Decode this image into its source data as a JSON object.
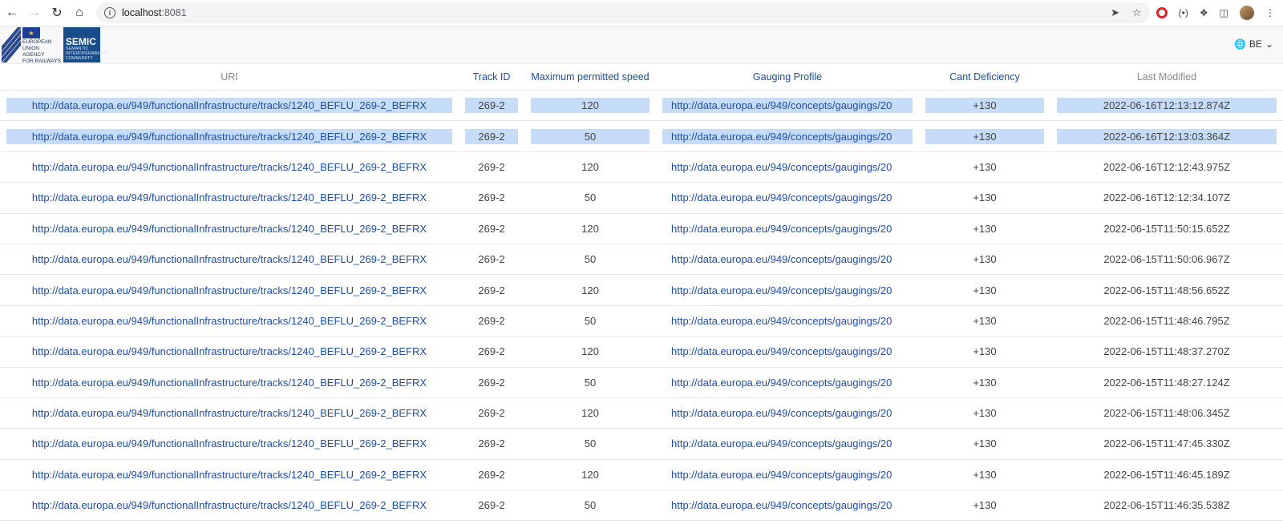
{
  "browser": {
    "url_host": "localhost",
    "url_port": ":8081"
  },
  "header": {
    "era_logo_text": [
      "EUROPEAN",
      "UNION",
      "AGENCY",
      "FOR RAILWAYS"
    ],
    "semic_title": "SEMIC",
    "semic_subtitle": [
      "SEMANTIC",
      "INTEROPERABILITY",
      "COMMUNITY"
    ],
    "language": "BE"
  },
  "table": {
    "columns": [
      "URI",
      "Track ID",
      "Maximum permitted speed",
      "Gauging Profile",
      "Cant Deficiency",
      "Last Modified"
    ],
    "rows": [
      {
        "uri": "http://data.europa.eu/949/functionalInfrastructure/tracks/1240_BEFLU_269-2_BEFRX",
        "track": "269-2",
        "speed": "120",
        "gauge": "http://data.europa.eu/949/concepts/gaugings/20",
        "cant": "+130",
        "modified": "2022-06-16T12:13:12.874Z",
        "selected": true
      },
      {
        "uri": "http://data.europa.eu/949/functionalInfrastructure/tracks/1240_BEFLU_269-2_BEFRX",
        "track": "269-2",
        "speed": "50",
        "gauge": "http://data.europa.eu/949/concepts/gaugings/20",
        "cant": "+130",
        "modified": "2022-06-16T12:13:03.364Z",
        "selected": true
      },
      {
        "uri": "http://data.europa.eu/949/functionalInfrastructure/tracks/1240_BEFLU_269-2_BEFRX",
        "track": "269-2",
        "speed": "120",
        "gauge": "http://data.europa.eu/949/concepts/gaugings/20",
        "cant": "+130",
        "modified": "2022-06-16T12:12:43.975Z",
        "selected": false
      },
      {
        "uri": "http://data.europa.eu/949/functionalInfrastructure/tracks/1240_BEFLU_269-2_BEFRX",
        "track": "269-2",
        "speed": "50",
        "gauge": "http://data.europa.eu/949/concepts/gaugings/20",
        "cant": "+130",
        "modified": "2022-06-16T12:12:34.107Z",
        "selected": false
      },
      {
        "uri": "http://data.europa.eu/949/functionalInfrastructure/tracks/1240_BEFLU_269-2_BEFRX",
        "track": "269-2",
        "speed": "120",
        "gauge": "http://data.europa.eu/949/concepts/gaugings/20",
        "cant": "+130",
        "modified": "2022-06-15T11:50:15.652Z",
        "selected": false
      },
      {
        "uri": "http://data.europa.eu/949/functionalInfrastructure/tracks/1240_BEFLU_269-2_BEFRX",
        "track": "269-2",
        "speed": "50",
        "gauge": "http://data.europa.eu/949/concepts/gaugings/20",
        "cant": "+130",
        "modified": "2022-06-15T11:50:06.967Z",
        "selected": false
      },
      {
        "uri": "http://data.europa.eu/949/functionalInfrastructure/tracks/1240_BEFLU_269-2_BEFRX",
        "track": "269-2",
        "speed": "120",
        "gauge": "http://data.europa.eu/949/concepts/gaugings/20",
        "cant": "+130",
        "modified": "2022-06-15T11:48:56.652Z",
        "selected": false
      },
      {
        "uri": "http://data.europa.eu/949/functionalInfrastructure/tracks/1240_BEFLU_269-2_BEFRX",
        "track": "269-2",
        "speed": "50",
        "gauge": "http://data.europa.eu/949/concepts/gaugings/20",
        "cant": "+130",
        "modified": "2022-06-15T11:48:46.795Z",
        "selected": false
      },
      {
        "uri": "http://data.europa.eu/949/functionalInfrastructure/tracks/1240_BEFLU_269-2_BEFRX",
        "track": "269-2",
        "speed": "120",
        "gauge": "http://data.europa.eu/949/concepts/gaugings/20",
        "cant": "+130",
        "modified": "2022-06-15T11:48:37.270Z",
        "selected": false
      },
      {
        "uri": "http://data.europa.eu/949/functionalInfrastructure/tracks/1240_BEFLU_269-2_BEFRX",
        "track": "269-2",
        "speed": "50",
        "gauge": "http://data.europa.eu/949/concepts/gaugings/20",
        "cant": "+130",
        "modified": "2022-06-15T11:48:27.124Z",
        "selected": false
      },
      {
        "uri": "http://data.europa.eu/949/functionalInfrastructure/tracks/1240_BEFLU_269-2_BEFRX",
        "track": "269-2",
        "speed": "120",
        "gauge": "http://data.europa.eu/949/concepts/gaugings/20",
        "cant": "+130",
        "modified": "2022-06-15T11:48:06.345Z",
        "selected": false
      },
      {
        "uri": "http://data.europa.eu/949/functionalInfrastructure/tracks/1240_BEFLU_269-2_BEFRX",
        "track": "269-2",
        "speed": "50",
        "gauge": "http://data.europa.eu/949/concepts/gaugings/20",
        "cant": "+130",
        "modified": "2022-06-15T11:47:45.330Z",
        "selected": false
      },
      {
        "uri": "http://data.europa.eu/949/functionalInfrastructure/tracks/1240_BEFLU_269-2_BEFRX",
        "track": "269-2",
        "speed": "120",
        "gauge": "http://data.europa.eu/949/concepts/gaugings/20",
        "cant": "+130",
        "modified": "2022-06-15T11:46:45.189Z",
        "selected": false
      },
      {
        "uri": "http://data.europa.eu/949/functionalInfrastructure/tracks/1240_BEFLU_269-2_BEFRX",
        "track": "269-2",
        "speed": "50",
        "gauge": "http://data.europa.eu/949/concepts/gaugings/20",
        "cant": "+130",
        "modified": "2022-06-15T11:46:35.538Z",
        "selected": false
      }
    ]
  },
  "colors": {
    "link": "#1e4fa0",
    "selection": "#c7dcf6"
  }
}
